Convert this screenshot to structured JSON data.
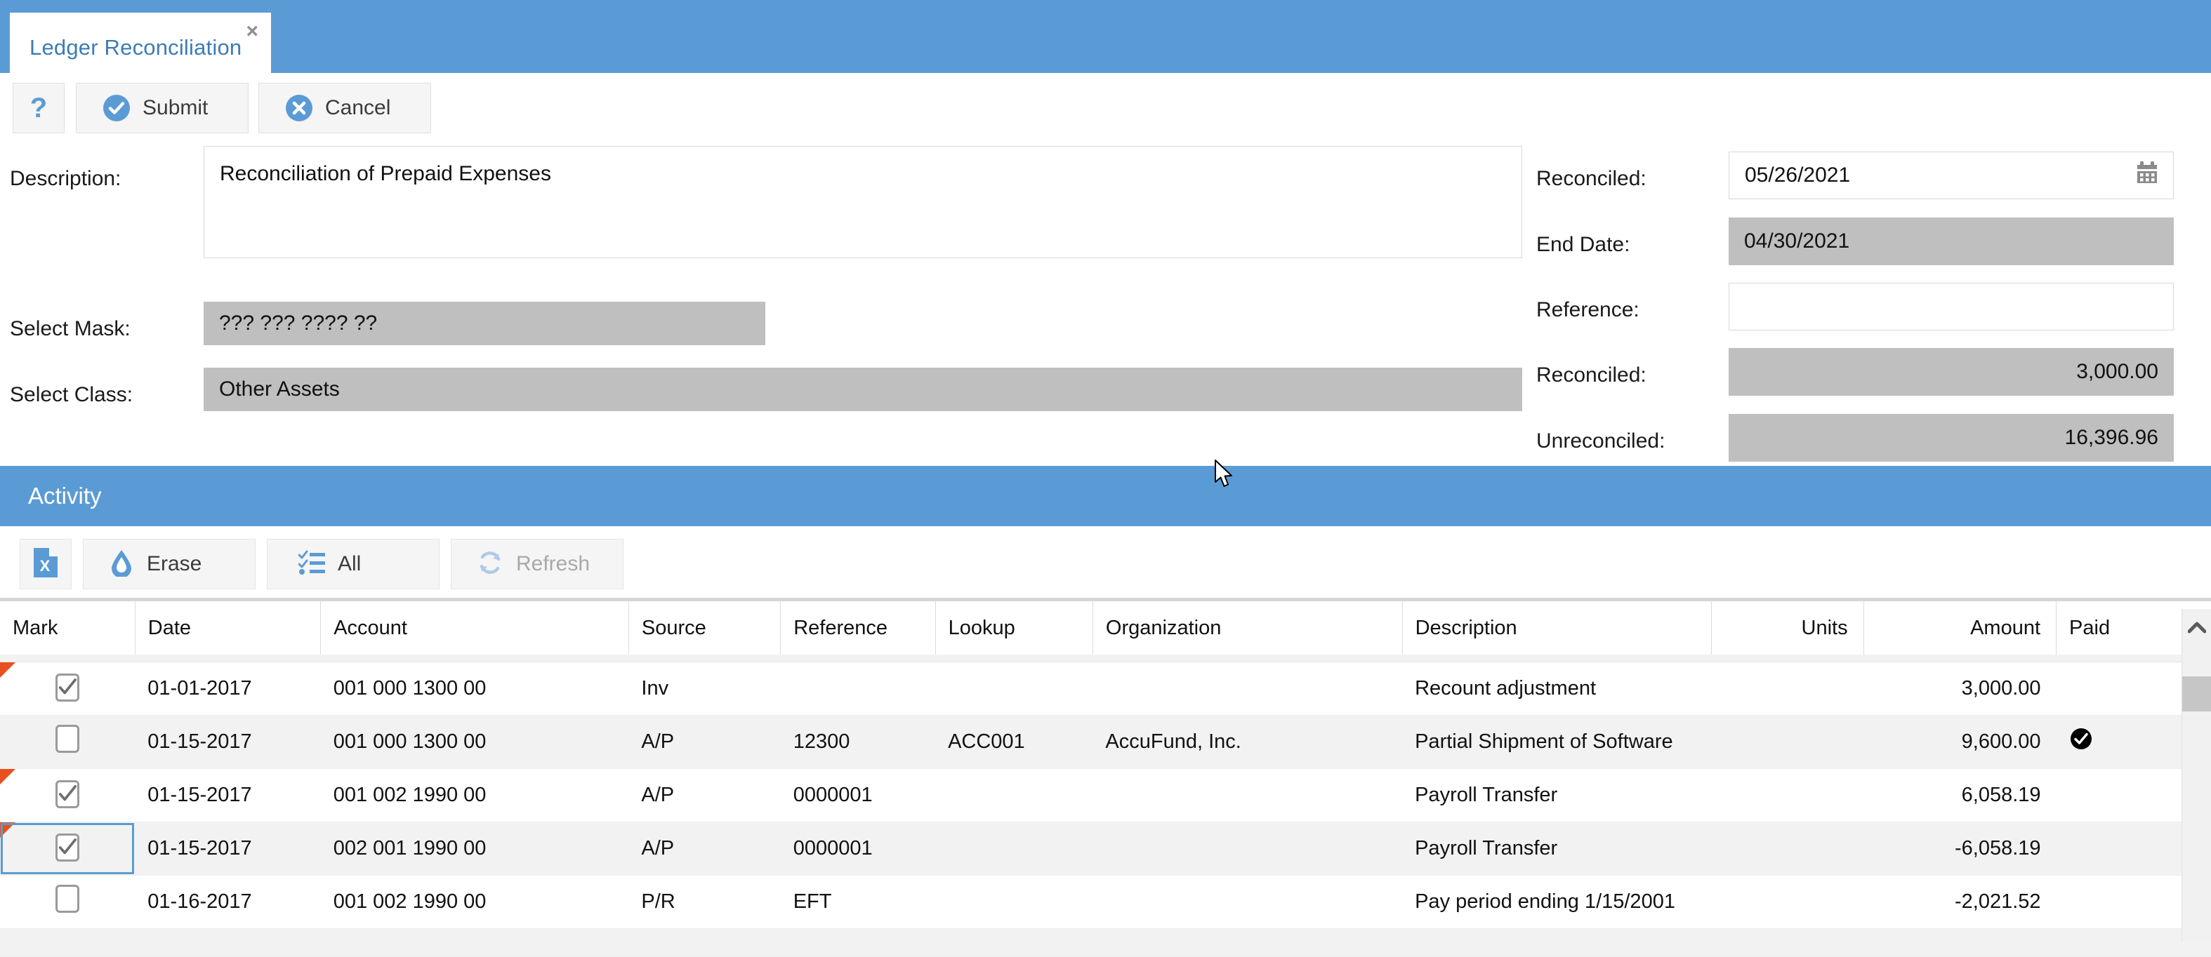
{
  "window": {
    "tab_label": "Ledger Reconciliation",
    "close_icon": "×"
  },
  "toolbar": {
    "help_label": "?",
    "submit_label": "Submit",
    "cancel_label": "Cancel"
  },
  "form": {
    "description_label": "Description:",
    "description_value": "Reconciliation of Prepaid Expenses",
    "select_mask_label": "Select Mask:",
    "select_mask_value": "??? ??? ???? ??",
    "select_class_label": "Select Class:",
    "select_class_value": "Other Assets",
    "reconciled_date_label": "Reconciled:",
    "reconciled_date_value": "05/26/2021",
    "end_date_label": "End Date:",
    "end_date_value": "04/30/2021",
    "reference_label": "Reference:",
    "reference_value": "",
    "reconciled_amount_label": "Reconciled:",
    "reconciled_amount_value": "3,000.00",
    "unreconciled_label": "Unreconciled:",
    "unreconciled_value": "16,396.96"
  },
  "activity": {
    "title": "Activity",
    "buttons": {
      "excel_label": "",
      "erase_label": "Erase",
      "all_label": "All",
      "refresh_label": "Refresh"
    },
    "columns": [
      "Mark",
      "Date",
      "Account",
      "Source",
      "Reference",
      "Lookup",
      "Organization",
      "Description",
      "Units",
      "Amount",
      "Paid"
    ],
    "rows": [
      {
        "marked": true,
        "flag": true,
        "focused": false,
        "date": "01-01-2017",
        "account": "001 000 1300 00",
        "source": "Inv",
        "reference": "",
        "lookup": "",
        "organization": "",
        "description": "Recount adjustment",
        "units": "",
        "amount": "3,000.00",
        "amount_sign": "pos",
        "paid": false
      },
      {
        "marked": false,
        "flag": false,
        "focused": false,
        "date": "01-15-2017",
        "account": "001 000 1300 00",
        "source": "A/P",
        "reference": "12300",
        "lookup": "ACC001",
        "organization": "AccuFund, Inc.",
        "description": "Partial Shipment of Software",
        "units": "",
        "amount": "9,600.00",
        "amount_sign": "pos",
        "paid": true
      },
      {
        "marked": true,
        "flag": true,
        "focused": false,
        "date": "01-15-2017",
        "account": "001 002 1990 00",
        "source": "A/P",
        "reference": "0000001",
        "lookup": "",
        "organization": "",
        "description": "Payroll Transfer",
        "units": "",
        "amount": "6,058.19",
        "amount_sign": "pos",
        "paid": false
      },
      {
        "marked": true,
        "flag": true,
        "focused": true,
        "date": "01-15-2017",
        "account": "002 001 1990 00",
        "source": "A/P",
        "reference": "0000001",
        "lookup": "",
        "organization": "",
        "description": "Payroll Transfer",
        "units": "",
        "amount": "-6,058.19",
        "amount_sign": "neg",
        "paid": false
      },
      {
        "marked": false,
        "flag": false,
        "focused": false,
        "date": "01-16-2017",
        "account": "001 002 1990 00",
        "source": "P/R",
        "reference": "EFT",
        "lookup": "",
        "organization": "",
        "description": "Pay period ending 1/15/2001",
        "units": "",
        "amount": "-2,021.52",
        "amount_sign": "neg",
        "paid": false
      }
    ]
  },
  "colors": {
    "brand_blue": "#5b9bd5",
    "tab_text": "#3c7cb4",
    "readonly_gray": "#bfbfbf",
    "amount_positive": "#00a000",
    "amount_negative": "#ff0000",
    "row_flag_red": "#e8501e"
  }
}
